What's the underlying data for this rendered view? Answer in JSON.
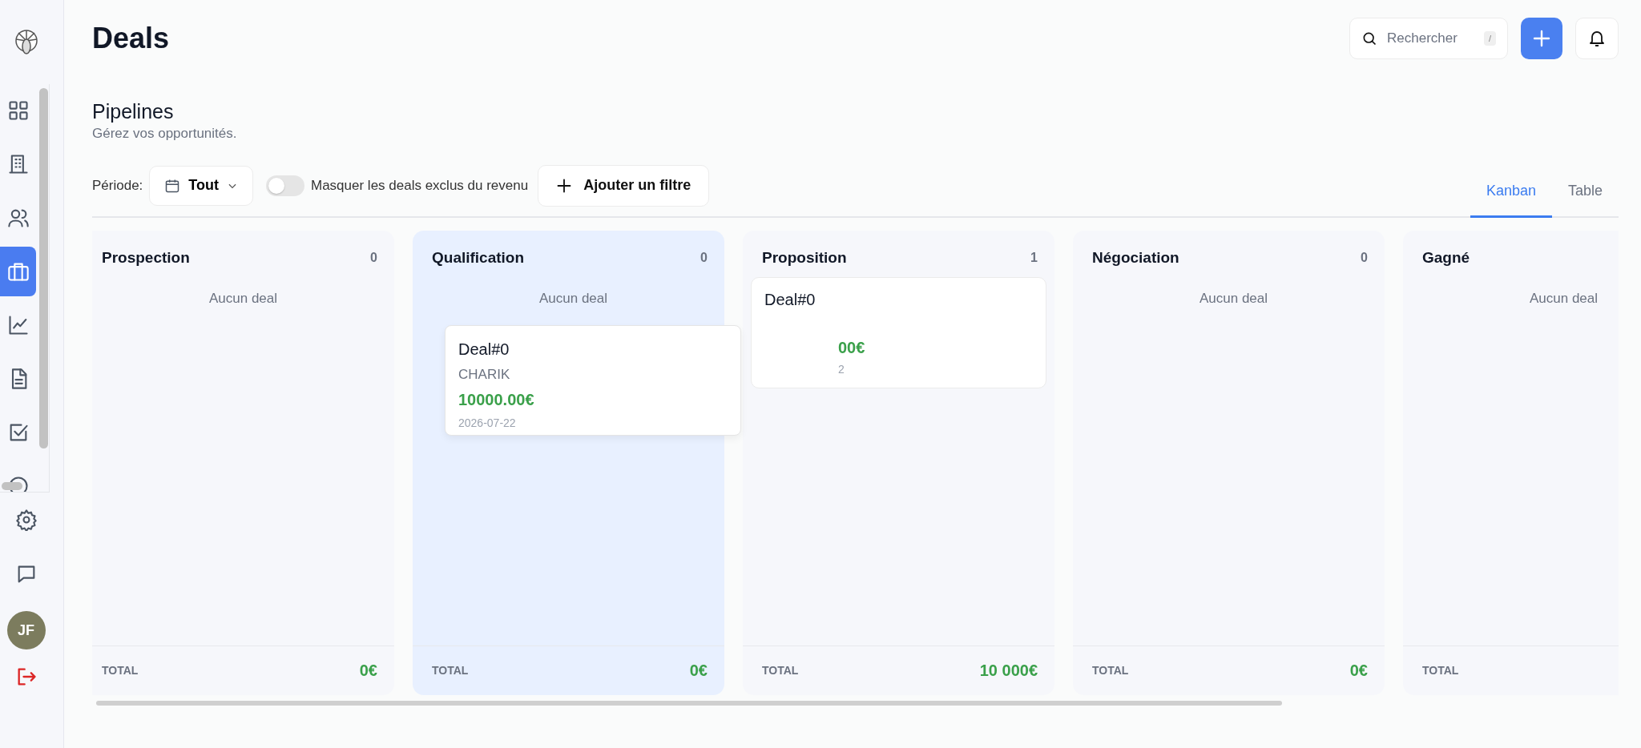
{
  "page": {
    "title": "Deals"
  },
  "sidebar": {
    "items": [
      {
        "kind": "grid",
        "selected": false
      },
      {
        "kind": "building",
        "selected": false
      },
      {
        "kind": "users",
        "selected": false
      },
      {
        "kind": "briefcase",
        "selected": true
      },
      {
        "kind": "chart",
        "selected": false
      },
      {
        "kind": "document",
        "selected": false
      },
      {
        "kind": "task",
        "selected": false
      },
      {
        "kind": "help",
        "selected": false
      }
    ],
    "bottom_items": [
      {
        "kind": "settings"
      },
      {
        "kind": "chat"
      }
    ],
    "avatar": {
      "initials": "JF"
    }
  },
  "header": {
    "search": {
      "placeholder": "Rechercher",
      "shortcut": "/"
    }
  },
  "section": {
    "title": "Pipelines",
    "subtitle": "Gérez vos opportunités."
  },
  "filters": {
    "period_label": "Période:",
    "period_value": "Tout",
    "toggle": {
      "label": "Masquer les deals exclus du revenu",
      "on": false
    },
    "add_filter": "Ajouter un filtre"
  },
  "view_tabs": [
    {
      "label": "Kanban",
      "selected": true
    },
    {
      "label": "Table",
      "selected": false
    }
  ],
  "columns": [
    {
      "name": "Prospection",
      "count": "0",
      "highlighted": false,
      "empty_text": "Aucun deal",
      "total_label": "TOTAL",
      "total": "0€"
    },
    {
      "name": "Qualification",
      "count": "0",
      "highlighted": true,
      "empty_text": "Aucun deal",
      "total_label": "TOTAL",
      "total": "0€"
    },
    {
      "name": "Proposition",
      "count": "1",
      "highlighted": false,
      "cards": [
        {
          "title": "Deal#0",
          "amount": "00€",
          "date": "2"
        }
      ],
      "total_label": "TOTAL",
      "total": "10 000€"
    },
    {
      "name": "Négociation",
      "count": "0",
      "highlighted": false,
      "empty_text": "Aucun deal",
      "total_label": "TOTAL",
      "total": "0€"
    },
    {
      "name": "Gagné",
      "highlighted": false,
      "empty_text": "Aucun deal",
      "total_label": "TOTAL"
    }
  ],
  "dragged_card": {
    "title": "Deal#0",
    "company": "CHARIK",
    "amount": "10000.00€",
    "date": "2026-07-22"
  }
}
